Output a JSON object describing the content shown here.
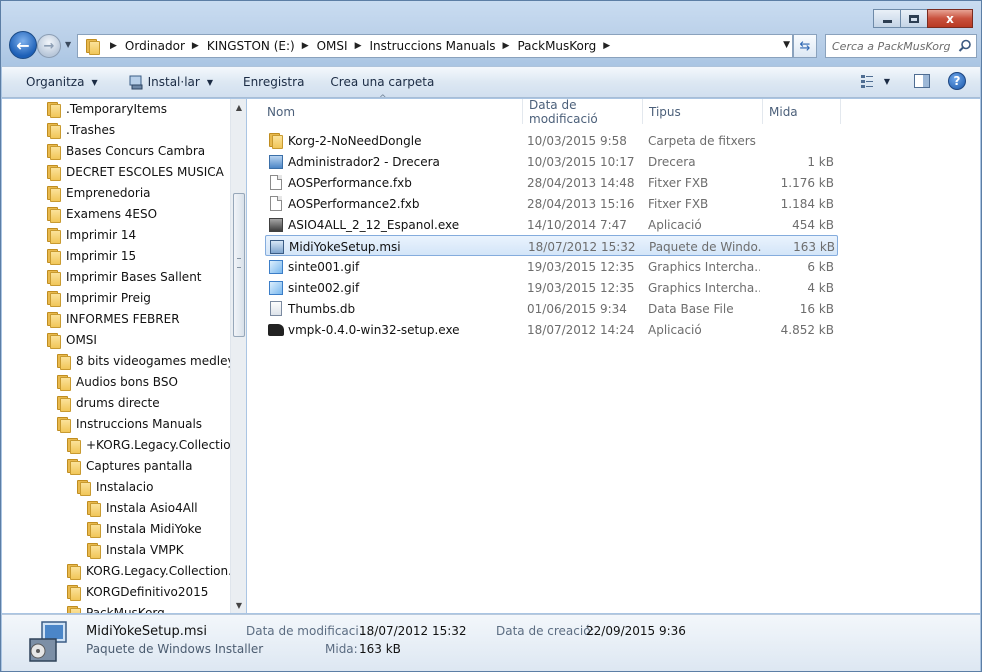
{
  "window": {
    "close_glyph": "x"
  },
  "nav": {
    "back_glyph": "←",
    "forward_glyph": "→",
    "breadcrumbs": [
      "Ordinador",
      "KINGSTON (E:)",
      "OMSI",
      "Instruccions Manuals",
      "PackMusKorg"
    ],
    "search_placeholder": "Cerca a PackMusKorg",
    "refresh_glyph": "⇆"
  },
  "commands": {
    "organize": "Organitza",
    "install": "Instal·lar",
    "record": "Enregistra",
    "new_folder": "Crea una carpeta",
    "help": "?"
  },
  "tree": [
    {
      "label": ".TemporaryItems",
      "level": 0
    },
    {
      "label": ".Trashes",
      "level": 0
    },
    {
      "label": "Bases Concurs Cambra",
      "level": 0
    },
    {
      "label": "DECRET ESCOLES MUSICA",
      "level": 0
    },
    {
      "label": "Emprenedoria",
      "level": 0
    },
    {
      "label": "Examens 4ESO",
      "level": 0
    },
    {
      "label": "Imprimir 14",
      "level": 0
    },
    {
      "label": "Imprimir 15",
      "level": 0
    },
    {
      "label": "Imprimir Bases Sallent",
      "level": 0
    },
    {
      "label": "Imprimir Preig",
      "level": 0
    },
    {
      "label": "INFORMES FEBRER",
      "level": 0
    },
    {
      "label": "OMSI",
      "level": 0
    },
    {
      "label": "8 bits videogames medley",
      "level": 1
    },
    {
      "label": "Audios bons BSO",
      "level": 1
    },
    {
      "label": "drums directe",
      "level": 1
    },
    {
      "label": "Instruccions Manuals",
      "level": 1
    },
    {
      "label": "+KORG.Legacy.Collection.Sp",
      "level": 2
    },
    {
      "label": "Captures pantalla",
      "level": 2
    },
    {
      "label": "Instalacio",
      "level": 3
    },
    {
      "label": "Instala Asio4All",
      "level": 4
    },
    {
      "label": "Instala MidiYoke",
      "level": 4
    },
    {
      "label": "Instala VMPK",
      "level": 4
    },
    {
      "label": "KORG.Legacy.Collection.Sp",
      "level": 2
    },
    {
      "label": "KORGDefinitivo2015",
      "level": 2
    },
    {
      "label": "PackMusKorg",
      "level": 2
    }
  ],
  "columns": {
    "name": "Nom",
    "date": "Data de modificació",
    "type": "Tipus",
    "size": "Mida"
  },
  "files": [
    {
      "name": "Korg-2-NoNeedDongle",
      "date": "10/03/2015 9:58",
      "type": "Carpeta de fitxers",
      "size": "",
      "icon": "folder-icon"
    },
    {
      "name": "Administrador2 - Drecera",
      "date": "10/03/2015 10:17",
      "type": "Drecera",
      "size": "1 kB",
      "icon": "shortcut-icon"
    },
    {
      "name": "AOSPerformance.fxb",
      "date": "28/04/2013 14:48",
      "type": "Fitxer FXB",
      "size": "1.176 kB",
      "icon": "document-icon"
    },
    {
      "name": "AOSPerformance2.fxb",
      "date": "28/04/2013 15:16",
      "type": "Fitxer FXB",
      "size": "1.184 kB",
      "icon": "document-icon"
    },
    {
      "name": "ASIO4ALL_2_12_Espanol.exe",
      "date": "14/10/2014 7:47",
      "type": "Aplicació",
      "size": "454 kB",
      "icon": "executable-icon"
    },
    {
      "name": "MidiYokeSetup.msi",
      "date": "18/07/2012 15:32",
      "type": "Paquete de Windo...",
      "size": "163 kB",
      "icon": "installer-icon"
    },
    {
      "name": "sinte001.gif",
      "date": "19/03/2015 12:35",
      "type": "Graphics Intercha...",
      "size": "6 kB",
      "icon": "image-icon"
    },
    {
      "name": "sinte002.gif",
      "date": "19/03/2015 12:35",
      "type": "Graphics Intercha...",
      "size": "4 kB",
      "icon": "image-icon"
    },
    {
      "name": "Thumbs.db",
      "date": "01/06/2015 9:34",
      "type": "Data Base File",
      "size": "16 kB",
      "icon": "database-icon"
    },
    {
      "name": "vmpk-0.4.0-win32-setup.exe",
      "date": "18/07/2012 14:24",
      "type": "Aplicació",
      "size": "4.852 kB",
      "icon": "piano-icon"
    }
  ],
  "selected_index": 5,
  "details": {
    "name": "MidiYokeSetup.msi",
    "type": "Paquete de Windows Installer",
    "modified_label": "Data de modificaci...",
    "modified_value": "18/07/2012 15:32",
    "size_label": "Mida:",
    "size_value": "163 kB",
    "created_label": "Data de creació:",
    "created_value": "22/09/2015 9:36"
  }
}
